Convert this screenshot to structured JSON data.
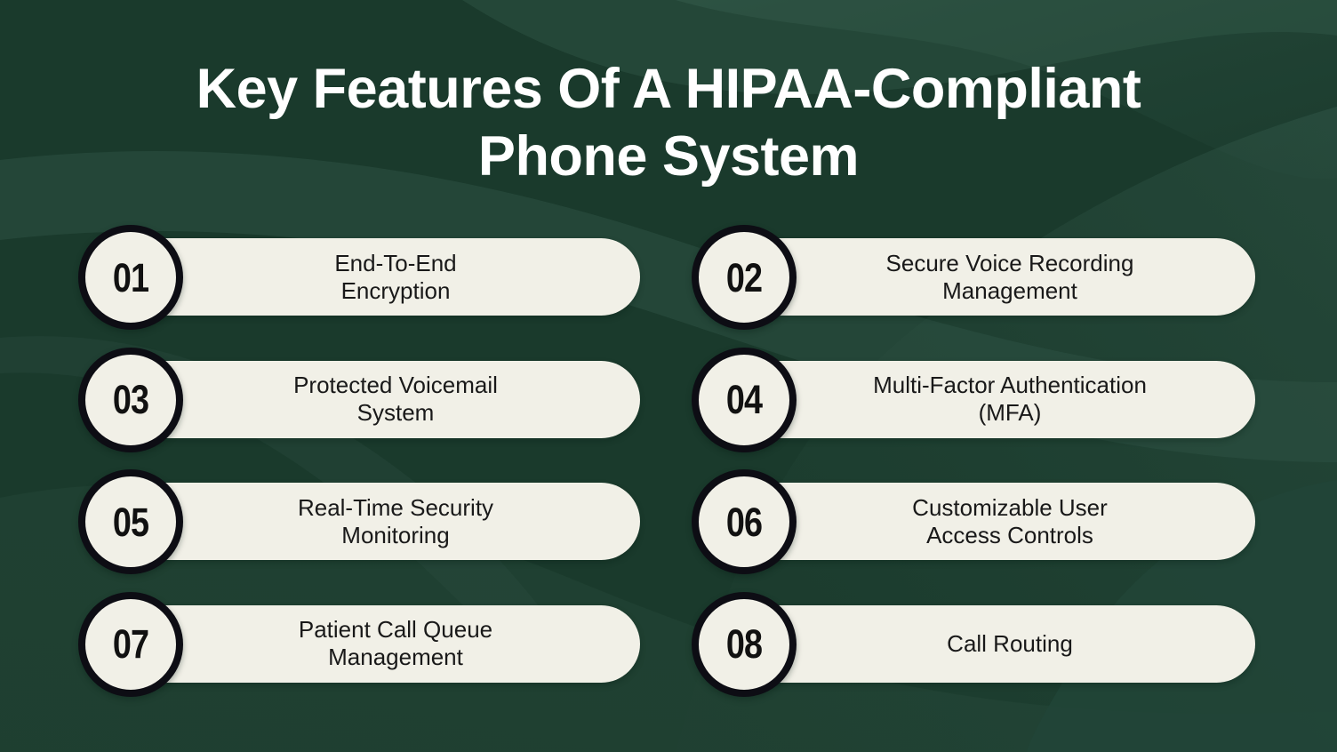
{
  "theme": {
    "background_color": "#1a3a2c",
    "wave_light_color": "#2f5242",
    "wave_lighter_color": "#3a5d4c",
    "pill_color": "#f1f0e7",
    "badge_ring_color": "#0d0d14",
    "title_color": "#ffffff",
    "label_color": "#191919"
  },
  "title": {
    "line1": "Key Features Of A HIPAA-Compliant",
    "line2": "Phone System"
  },
  "items": [
    {
      "number": "01",
      "label": "End-To-End\nEncryption"
    },
    {
      "number": "02",
      "label": "Secure Voice Recording\nManagement"
    },
    {
      "number": "03",
      "label": "Protected Voicemail\nSystem"
    },
    {
      "number": "04",
      "label": "Multi-Factor Authentication\n(MFA)"
    },
    {
      "number": "05",
      "label": "Real-Time Security\nMonitoring"
    },
    {
      "number": "06",
      "label": "Customizable User\nAccess Controls"
    },
    {
      "number": "07",
      "label": "Patient Call Queue\nManagement"
    },
    {
      "number": "08",
      "label": "Call Routing"
    }
  ]
}
